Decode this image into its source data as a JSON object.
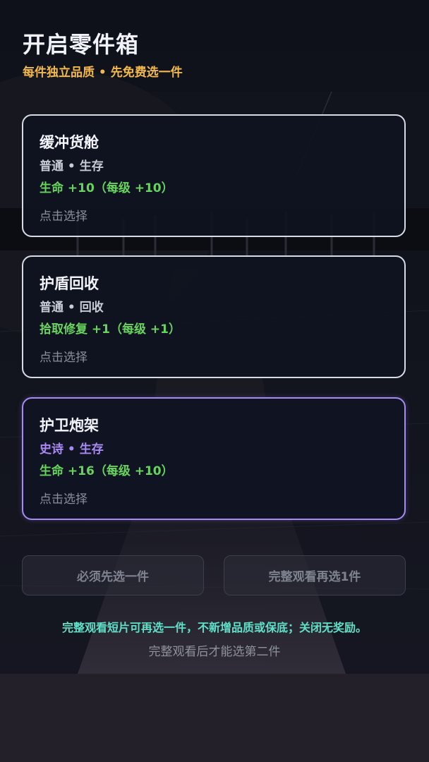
{
  "header": {
    "title": "开启零件箱",
    "subtitle": "每件独立品质 • 先免费选一件"
  },
  "cards": [
    {
      "name": "缓冲货舱",
      "meta": "普通 • 生存",
      "stat": "生命 +10（每级 +10）",
      "hint": "点击选择",
      "rarity": "common"
    },
    {
      "name": "护盾回收",
      "meta": "普通 • 回收",
      "stat": "拾取修复 +1（每级 +1）",
      "hint": "点击选择",
      "rarity": "common"
    },
    {
      "name": "护卫炮架",
      "meta": "史诗 • 生存",
      "stat": "生命 +16（每级 +10）",
      "hint": "点击选择",
      "rarity": "epic"
    }
  ],
  "buttons": {
    "pick_first": "必须先选一件",
    "watch_pick": "完整观看再选1件"
  },
  "notice": "完整观看短片可再选一件，不新增品质或保底；关闭无奖励。",
  "sub_notice": "完整观看后才能选第二件",
  "colors": {
    "subtitle": "#f2b84b",
    "stat_green": "#67d45d",
    "epic_purple": "#a78bf3",
    "notice_teal": "#5fe0c8",
    "card_border": "#d7dbe4"
  }
}
